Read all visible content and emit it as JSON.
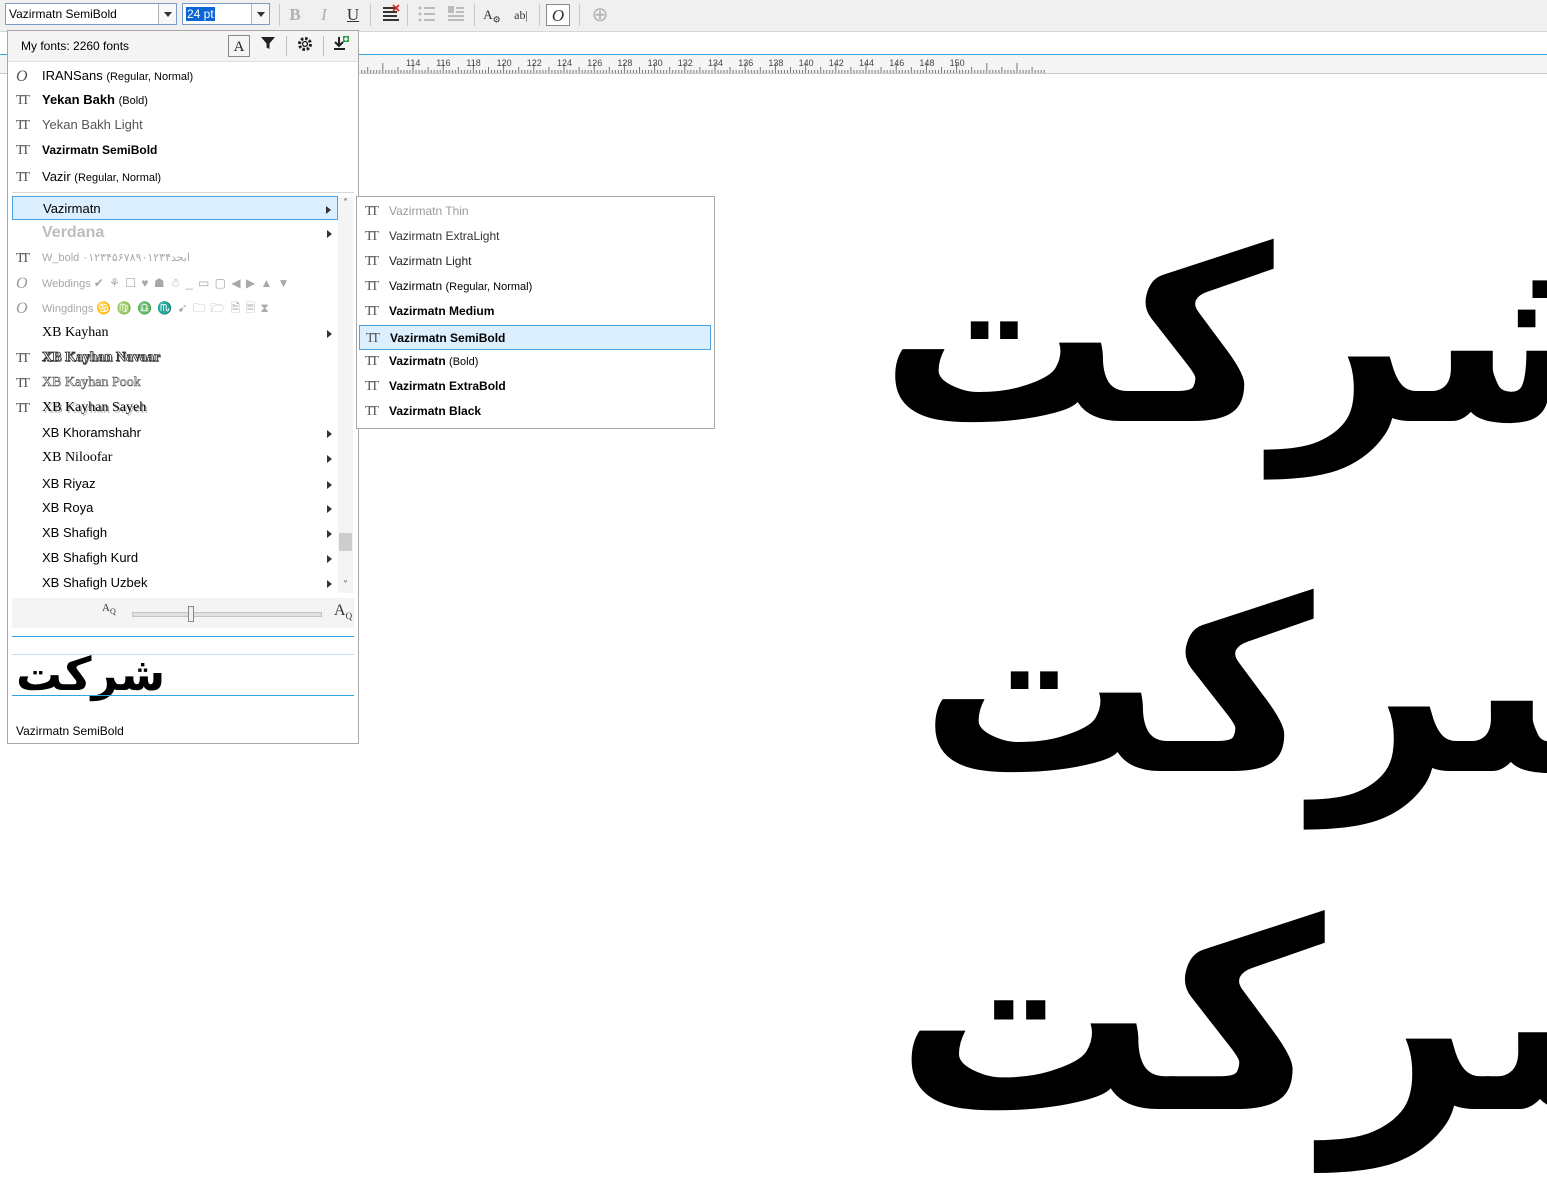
{
  "toolbar": {
    "font_name": "Vazirmatn SemiBold",
    "font_size": "24 pt",
    "bold_icon": "B",
    "italic_icon": "I",
    "underline_icon": "U",
    "icons": [
      "bold-icon",
      "italic-icon",
      "underline-icon",
      "text-align-icon",
      "bullet-list-icon",
      "drop-cap-icon",
      "character-formatting-icon",
      "edit-text-icon",
      "opentype-icon",
      "add-icon"
    ]
  },
  "ruler": {
    "labels": [
      "114",
      "116",
      "118",
      "120",
      "122",
      "124",
      "126",
      "128",
      "130",
      "132",
      "134",
      "136",
      "138",
      "140",
      "142",
      "144",
      "146",
      "148",
      "150"
    ]
  },
  "canvas": {
    "words": [
      "شرکت",
      "شرکت",
      "شرکت"
    ]
  },
  "font_list": {
    "count_label": "My fonts: 2260 fonts",
    "recent": [
      {
        "icon": "opentype-icon",
        "name": "IRANSans",
        "style": "(Regular, Normal)"
      },
      {
        "icon": "truetype-icon",
        "name": "Yekan Bakh",
        "style": "(Bold)"
      },
      {
        "icon": "truetype-icon",
        "name": "Yekan Bakh Light",
        "style": ""
      },
      {
        "icon": "truetype-icon",
        "name": "Vazirmatn SemiBold",
        "style": ""
      },
      {
        "icon": "truetype-icon",
        "name": "Vazir",
        "style": "(Regular, Normal)"
      }
    ],
    "items": [
      {
        "icon": "",
        "name": "Vazirmatn",
        "has_submenu": true,
        "selected": true
      },
      {
        "icon": "",
        "name": "Verdana",
        "has_submenu": true
      },
      {
        "icon": "truetype-icon",
        "name": "W_bold",
        "sample": "ابجد۰۱۲۳۴۵۶۷۸۹۰۱۲۳۴"
      },
      {
        "icon": "opentype-icon",
        "name": "Webdings",
        "sample": "✔ ⚘ ☐ ♥ ☗ ☃ _ ▭ ▢ ◀ ▶ ▲ ▼"
      },
      {
        "icon": "opentype-icon",
        "name": "Wingdings",
        "sample": "♋ ♍ ♎ ♏ ➹ 🗀 🗁 🗎 🗏 ⧗"
      },
      {
        "icon": "",
        "name": "XB Kayhan",
        "has_submenu": true
      },
      {
        "icon": "truetype-icon",
        "name": "XB Kayhan Navaar"
      },
      {
        "icon": "truetype-icon",
        "name": "XB Kayhan Pook"
      },
      {
        "icon": "truetype-icon",
        "name": "XB Kayhan Sayeh"
      },
      {
        "icon": "",
        "name": "XB Khoramshahr",
        "has_submenu": true
      },
      {
        "icon": "",
        "name": "XB Niloofar",
        "has_submenu": true
      },
      {
        "icon": "",
        "name": "XB Riyaz",
        "has_submenu": true
      },
      {
        "icon": "",
        "name": "XB Roya",
        "has_submenu": true
      },
      {
        "icon": "",
        "name": "XB Shafigh",
        "has_submenu": true
      },
      {
        "icon": "",
        "name": "XB Shafigh Kurd",
        "has_submenu": true
      },
      {
        "icon": "",
        "name": "XB Shafigh Uzbek",
        "has_submenu": true
      }
    ],
    "zoom_level": 0.3,
    "scroll_position": 0.92,
    "preview_text": "شرکت",
    "preview_name": "Vazirmatn SemiBold"
  },
  "submenu": {
    "items": [
      {
        "name": "Vazirmatn Thin",
        "style": ""
      },
      {
        "name": "Vazirmatn ExtraLight",
        "style": ""
      },
      {
        "name": "Vazirmatn Light",
        "style": ""
      },
      {
        "name": "Vazirmatn",
        "style": "(Regular, Normal)"
      },
      {
        "name": "Vazirmatn Medium",
        "style": ""
      },
      {
        "name": "Vazirmatn SemiBold",
        "style": "",
        "selected": true
      },
      {
        "name": "Vazirmatn",
        "style": "(Bold)"
      },
      {
        "name": "Vazirmatn ExtraBold",
        "style": ""
      },
      {
        "name": "Vazirmatn Black",
        "style": ""
      }
    ]
  },
  "colors": {
    "accent": "#33a3dc",
    "selection": "#dcefff",
    "highlight_text_bg": "#0a66d6"
  }
}
